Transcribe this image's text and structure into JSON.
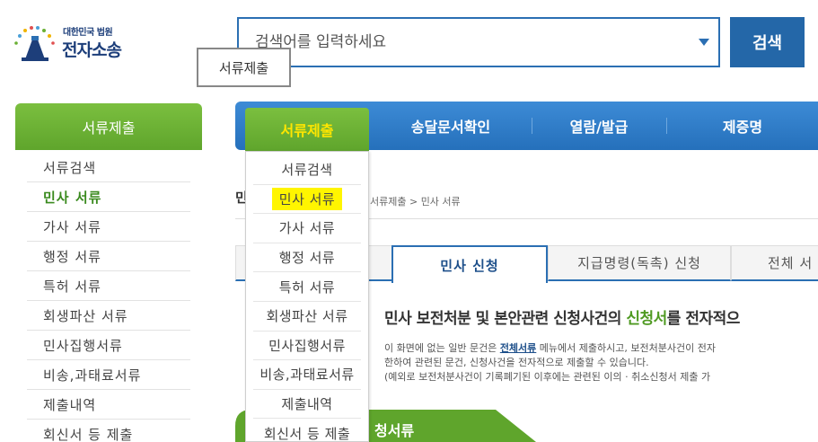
{
  "logo": {
    "line1": "대한민국 법원",
    "line2": "전자소송"
  },
  "search": {
    "placeholder": "검색어를 입력하세요",
    "button_label": "검색"
  },
  "tooltip": "서류제출",
  "sidebar": {
    "title": "서류제출",
    "items": [
      {
        "label": "서류검색"
      },
      {
        "label": "민사 서류"
      },
      {
        "label": "가사 서류"
      },
      {
        "label": "행정 서류"
      },
      {
        "label": "특허 서류"
      },
      {
        "label": "회생파산 서류"
      },
      {
        "label": "민사집행서류"
      },
      {
        "label": "비송,과태료서류"
      },
      {
        "label": "제출내역"
      },
      {
        "label": "회신서 등 제출"
      }
    ]
  },
  "topnav": {
    "items": [
      {
        "label": "서류제출"
      },
      {
        "label": "송달문서확인"
      },
      {
        "label": "열람/발급"
      },
      {
        "label": "제증명"
      }
    ]
  },
  "dropdown": {
    "items": [
      {
        "label": "서류검색"
      },
      {
        "label": "민사 서류"
      },
      {
        "label": "가사 서류"
      },
      {
        "label": "행정 서류"
      },
      {
        "label": "특허 서류"
      },
      {
        "label": "회생파산 서류"
      },
      {
        "label": "민사집행서류"
      },
      {
        "label": "비송,과태료서류"
      },
      {
        "label": "제출내역"
      },
      {
        "label": "회신서 등 제출"
      }
    ]
  },
  "content": {
    "title_initial": "민",
    "breadcrumb": "서류제출 > 민사 서류",
    "tabs": [
      {
        "label": "민사 신청"
      },
      {
        "label": "지급명령(독촉) 신청"
      },
      {
        "label": "전체 서"
      }
    ],
    "headline_before": "민사 보전처분 및 본안관련 신청사건의 ",
    "headline_green": "신청서",
    "headline_after": "를 전자적으",
    "desc_line1_before": "이 화면에 없는 일반 문건은 ",
    "desc_line1_link": "전체서류",
    "desc_line1_after": " 메뉴에서 제출하시고, 보전처분사건이 전자",
    "desc_line2": "한하여 관련된 문건, 신청사건을 전자적으로 제출할 수 있습니다.",
    "desc_line3": "(예외로 보전처분사건이 기록폐기된 이후에는 관련된 이의 · 취소신청서 제출 가",
    "section_title": "청서류"
  },
  "colors": {
    "nav_blue": "#2b6fb3",
    "menu_green": "#6ab034",
    "highlight_yellow": "#fff500"
  }
}
